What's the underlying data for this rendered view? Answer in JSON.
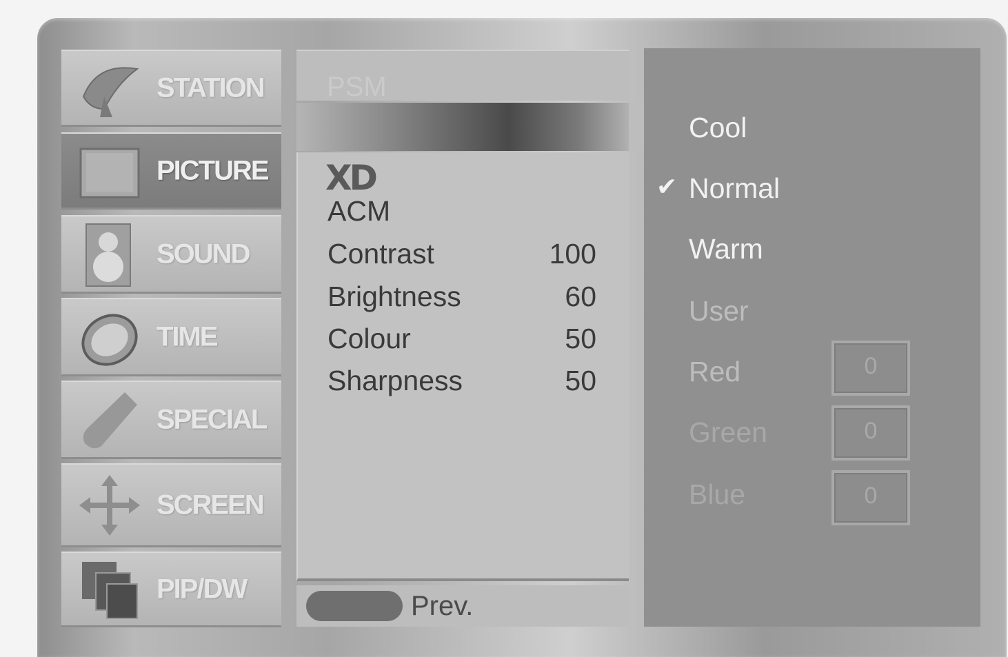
{
  "menu": {
    "categories": [
      {
        "label": "STATION",
        "icon": "satellite-dish-icon"
      },
      {
        "label": "PICTURE",
        "icon": "tv-screen-icon"
      },
      {
        "label": "SOUND",
        "icon": "speaker-icon"
      },
      {
        "label": "TIME",
        "icon": "clock-icon"
      },
      {
        "label": "SPECIAL",
        "icon": "wrench-icon"
      },
      {
        "label": "SCREEN",
        "icon": "move-arrows-icon"
      },
      {
        "label": "PIP/DW",
        "icon": "pip-windows-icon"
      }
    ],
    "selected": "PICTURE"
  },
  "submenu": {
    "header": "PSM",
    "logo": "XD",
    "acm_label": "ACM",
    "items": [
      {
        "label": "Contrast",
        "value": "100"
      },
      {
        "label": "Brightness",
        "value": "60"
      },
      {
        "label": "Colour",
        "value": "50"
      },
      {
        "label": "Sharpness",
        "value": "50"
      }
    ],
    "prev_label": "Prev."
  },
  "colour_temp": {
    "options": [
      "Cool",
      "Normal",
      "Warm",
      "User"
    ],
    "selected": "Normal",
    "check_mark": "✔",
    "user_channels": [
      {
        "label": "Red",
        "value": "0"
      },
      {
        "label": "Green",
        "value": "0"
      },
      {
        "label": "Blue",
        "value": "0"
      }
    ]
  }
}
